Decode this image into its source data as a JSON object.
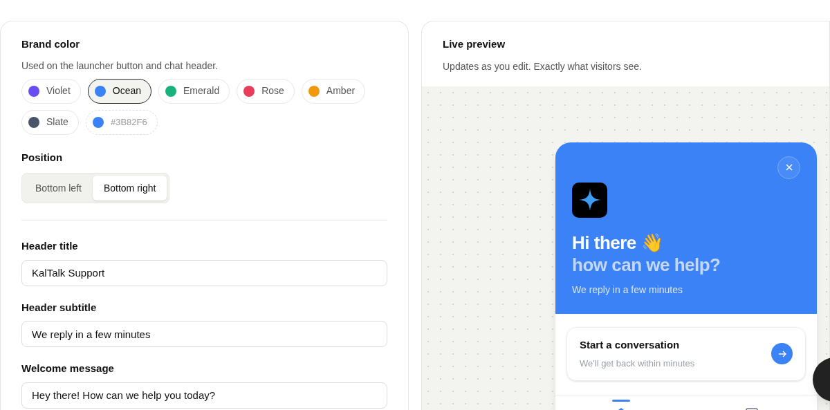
{
  "brand_color": {
    "label": "Brand color",
    "hint": "Used on the launcher button and chat header.",
    "swatches": [
      {
        "label": "Violet",
        "color": "#6a4cf5",
        "selected": false
      },
      {
        "label": "Ocean",
        "color": "#3b82f6",
        "selected": true
      },
      {
        "label": "Emerald",
        "color": "#19b27c",
        "selected": false
      },
      {
        "label": "Rose",
        "color": "#e83e5c",
        "selected": false
      },
      {
        "label": "Amber",
        "color": "#f0990f",
        "selected": false
      },
      {
        "label": "Slate",
        "color": "#485468",
        "selected": false
      }
    ],
    "custom": {
      "value": "#3B82F6",
      "color": "#3b82f6"
    }
  },
  "position": {
    "label": "Position",
    "options": [
      {
        "label": "Bottom left",
        "selected": false
      },
      {
        "label": "Bottom right",
        "selected": true
      }
    ]
  },
  "fields": [
    {
      "label": "Header title",
      "value": "KalTalk Support"
    },
    {
      "label": "Header subtitle",
      "value": "We reply in a few minutes"
    },
    {
      "label": "Welcome message",
      "value": "Hey there! How can we help you today?"
    }
  ],
  "preview": {
    "title": "Live preview",
    "subtitle": "Updates as you edit. Exactly what visitors see.",
    "widget": {
      "greeting": "Hi there 👋",
      "question": "how can we help?",
      "subtitle": "We reply in a few minutes",
      "card_title": "Start a conversation",
      "card_subtitle": "We'll get back within minutes",
      "nav": [
        {
          "kind": "home",
          "selected": true
        },
        {
          "kind": "chat",
          "selected": false
        }
      ]
    }
  }
}
